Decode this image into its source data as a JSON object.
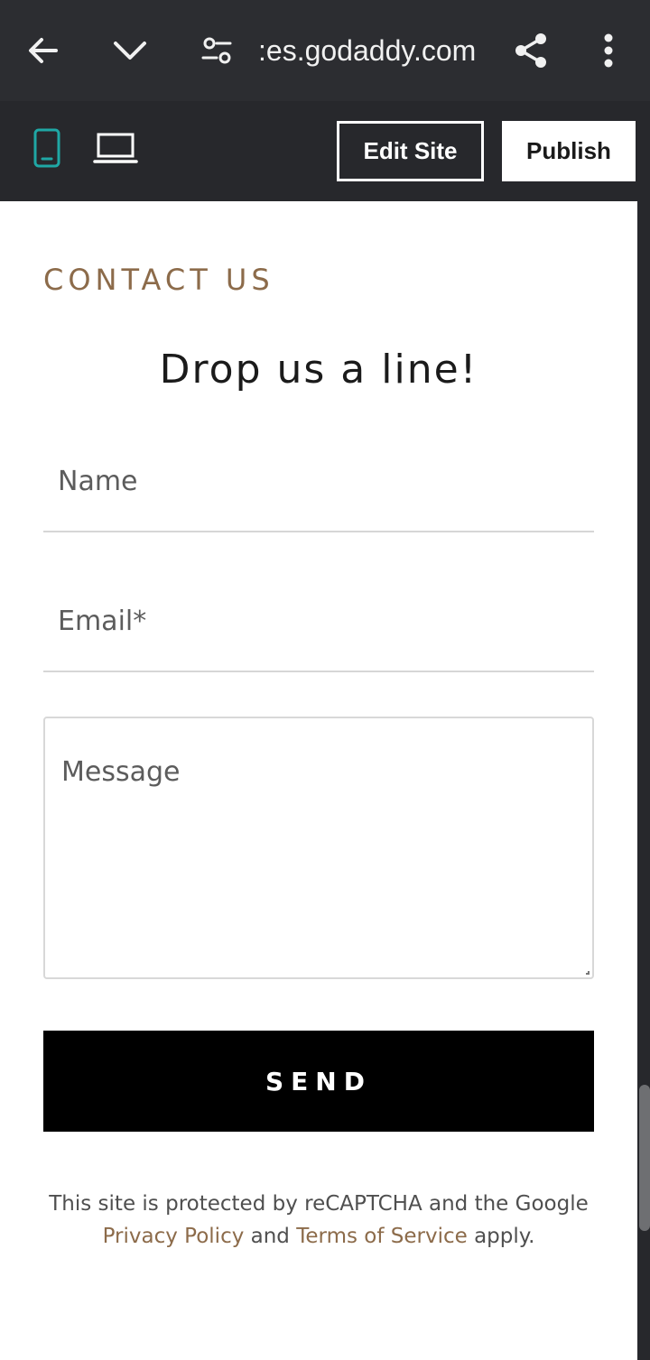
{
  "browser": {
    "url_text": ":es.godaddy.com",
    "icons": [
      "back-arrow-icon",
      "chevron-down-icon",
      "site-settings-icon",
      "share-icon",
      "more-vert-icon"
    ]
  },
  "editor_toolbar": {
    "device_icons": [
      "mobile-icon",
      "laptop-icon"
    ],
    "active_device": "mobile",
    "accent_color": "#1fa7a5",
    "edit_site_label": "Edit Site",
    "publish_label": "Publish"
  },
  "contact": {
    "section_label": "CONTACT US",
    "headline": "Drop us a line!",
    "name_placeholder": "Name",
    "email_placeholder": "Email*",
    "message_placeholder": "Message",
    "send_label": "SEND",
    "recaptcha": {
      "text_before": "This site is protected by reCAPTCHA and the Google",
      "privacy_link": "Privacy Policy",
      "and_text": "and",
      "terms_link": "Terms of Service",
      "text_after": "apply."
    },
    "colors": {
      "accent": "#8c6b4a",
      "button": "#000000"
    }
  }
}
